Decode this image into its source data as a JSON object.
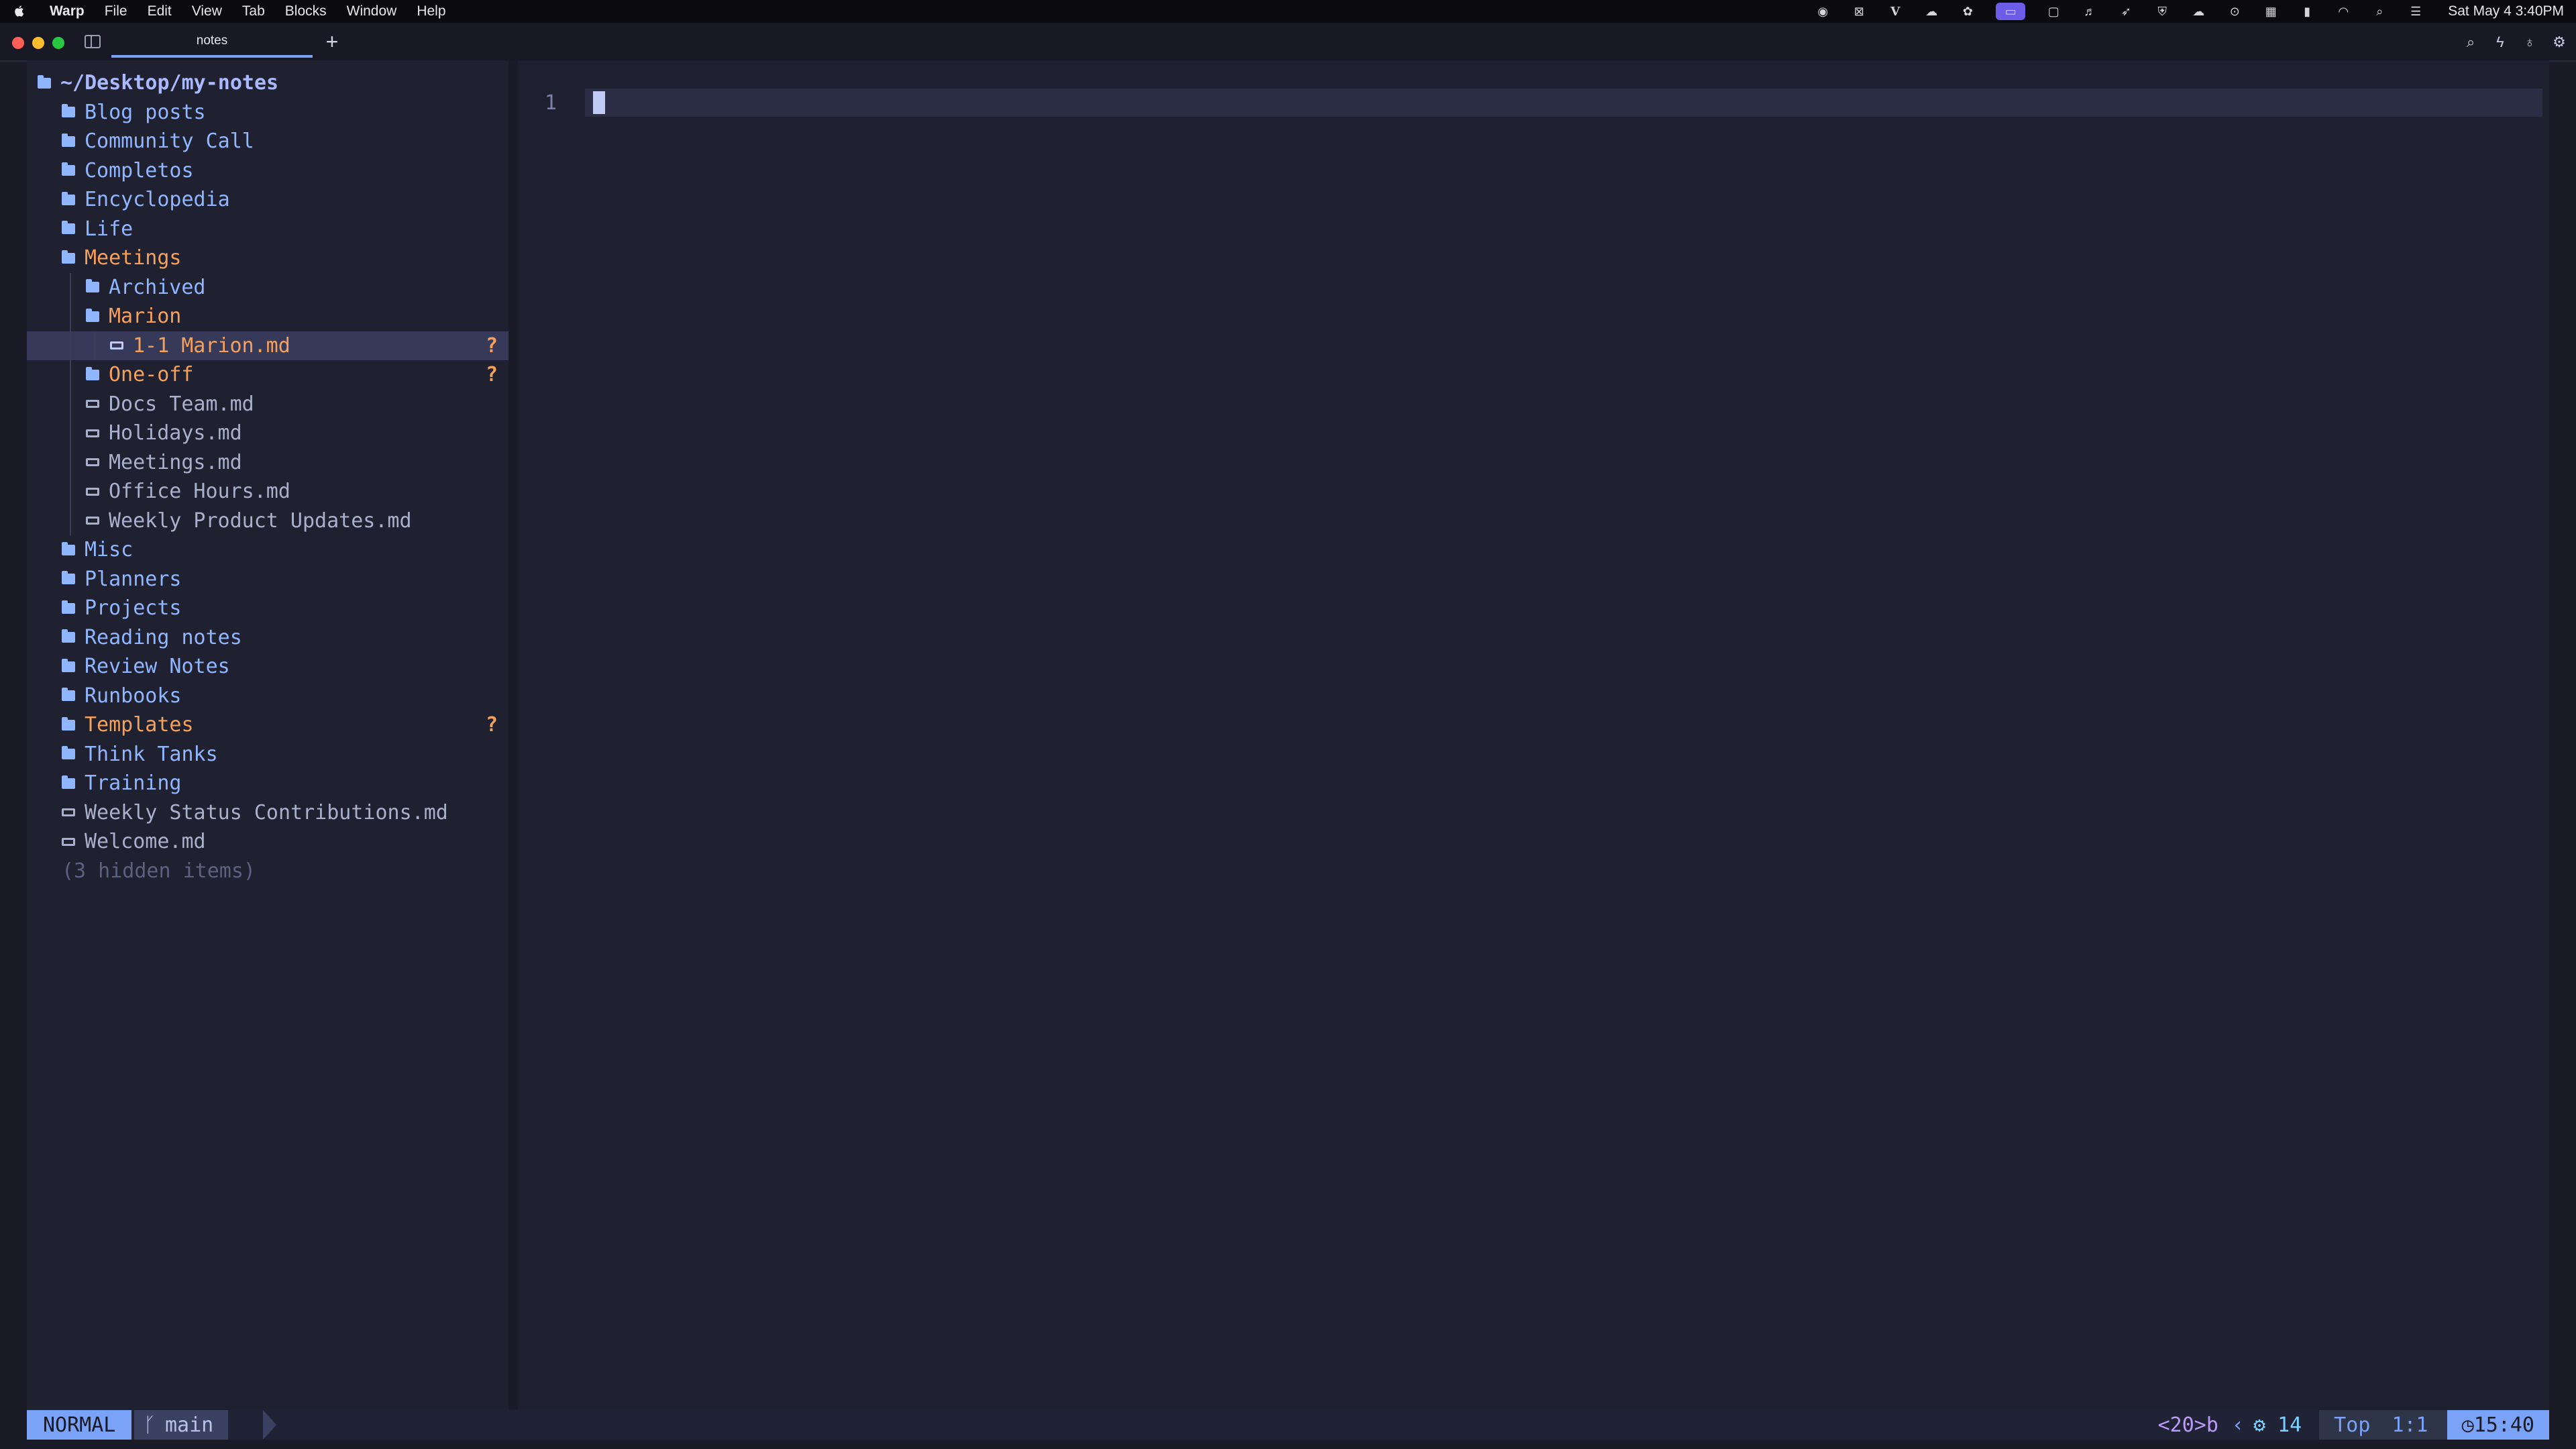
{
  "menubar": {
    "app_name": "Warp",
    "items": [
      "File",
      "Edit",
      "View",
      "Tab",
      "Blocks",
      "Window",
      "Help"
    ],
    "status_icons": [
      "record-icon",
      "close-box-icon",
      "vim-icon",
      "cloud-sync-icon",
      "chatgpt-icon",
      "window-switcher-icon",
      "display-icon",
      "audio-icon",
      "rocket-icon",
      "vpn-icon",
      "cloud-icon",
      "media-icon",
      "grid-icon",
      "battery-icon",
      "wifi-icon",
      "spotlight-icon",
      "control-center-icon"
    ],
    "clock": "Sat May 4  3:40PM"
  },
  "window": {
    "tab_label": "notes",
    "new_tab_label": "+",
    "toolbar_icons": [
      "search-icon",
      "lightning-icon",
      "lightbulb-icon",
      "settings-icon"
    ]
  },
  "tree": {
    "root": "~/Desktop/my-notes",
    "items": [
      {
        "label": "Blog posts",
        "kind": "folder",
        "depth": 1
      },
      {
        "label": "Community Call",
        "kind": "folder",
        "depth": 1
      },
      {
        "label": "Completos",
        "kind": "folder",
        "depth": 1
      },
      {
        "label": "Encyclopedia",
        "kind": "folder",
        "depth": 1
      },
      {
        "label": "Life",
        "kind": "folder",
        "depth": 1
      },
      {
        "label": "Meetings",
        "kind": "folder-open",
        "depth": 1
      },
      {
        "label": "Archived",
        "kind": "folder",
        "depth": 2
      },
      {
        "label": "Marion",
        "kind": "folder-open",
        "depth": 2
      },
      {
        "label": "1-1 Marion.md",
        "kind": "file-hl",
        "depth": 3,
        "mark": "?"
      },
      {
        "label": "One-off",
        "kind": "folder-open-closed",
        "depth": 2,
        "mark": "?"
      },
      {
        "label": "Docs Team.md",
        "kind": "file",
        "depth": 2
      },
      {
        "label": "Holidays.md",
        "kind": "file",
        "depth": 2
      },
      {
        "label": "Meetings.md",
        "kind": "file",
        "depth": 2
      },
      {
        "label": "Office Hours.md",
        "kind": "file",
        "depth": 2
      },
      {
        "label": "Weekly Product Updates.md",
        "kind": "file",
        "depth": 2
      },
      {
        "label": "Misc",
        "kind": "folder",
        "depth": 1
      },
      {
        "label": "Planners",
        "kind": "folder",
        "depth": 1
      },
      {
        "label": "Projects",
        "kind": "folder",
        "depth": 1
      },
      {
        "label": "Reading notes",
        "kind": "folder",
        "depth": 1
      },
      {
        "label": "Review Notes",
        "kind": "folder",
        "depth": 1
      },
      {
        "label": "Runbooks",
        "kind": "folder",
        "depth": 1
      },
      {
        "label": "Templates",
        "kind": "folder-open-closed",
        "depth": 1,
        "mark": "?"
      },
      {
        "label": "Think Tanks",
        "kind": "folder",
        "depth": 1
      },
      {
        "label": "Training",
        "kind": "folder",
        "depth": 1
      },
      {
        "label": "Weekly Status Contributions.md",
        "kind": "file",
        "depth": 1
      },
      {
        "label": "Welcome.md",
        "kind": "file",
        "depth": 1
      }
    ],
    "hidden_note": "(3 hidden items)"
  },
  "editor": {
    "line_number": "1"
  },
  "statusline": {
    "mode": "NORMAL",
    "branch_icon": "git-branch-icon",
    "branch": "main",
    "keys": "<20>b",
    "lsp_count": "14",
    "position": "Top",
    "cursor": "1:1",
    "time": "15:40"
  },
  "colors": {
    "background": "#1e1e2e",
    "accent": "#7aa2f7",
    "folder": "#8fb6ff",
    "modified": "#f5a05b"
  }
}
